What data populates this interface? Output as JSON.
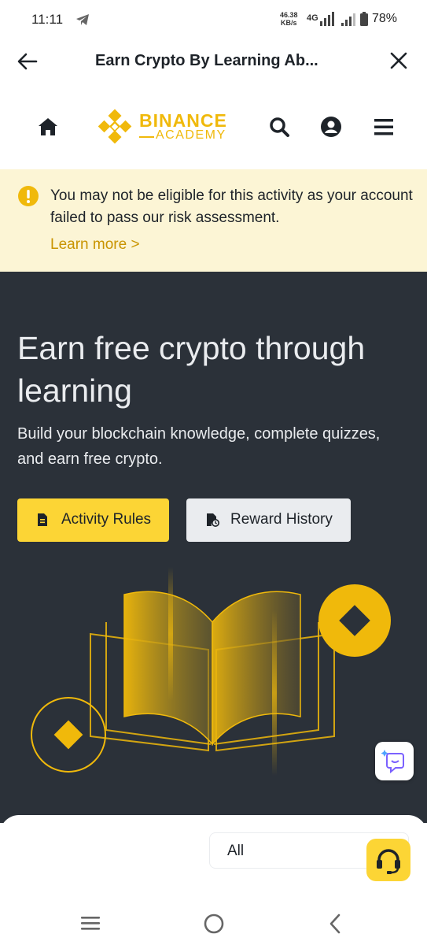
{
  "status_bar": {
    "time": "11:11",
    "net_speed_value": "46.38",
    "net_speed_unit": "KB/s",
    "network": "4G",
    "battery": "78%"
  },
  "nav": {
    "title": "Earn Crypto By Learning Ab..."
  },
  "header": {
    "logo_main": "BINANCE",
    "logo_sub": "ACADEMY",
    "icons": [
      "home-icon",
      "search-icon",
      "account-icon",
      "menu-icon"
    ]
  },
  "alert": {
    "message": "You may not be eligible for this activity as your account failed to pass our risk assessment.",
    "link": "Learn more >"
  },
  "hero": {
    "title": "Earn free crypto through learning",
    "subtitle": "Build your blockchain knowledge, complete quizzes, and earn free crypto.",
    "rules_button": "Activity Rules",
    "history_button": "Reward History"
  },
  "filter": {
    "selected": "All"
  },
  "colors": {
    "brand_yellow": "#fcd535",
    "gold": "#f0b90b",
    "hero_bg": "#2b3139",
    "alert_bg": "#fcf5d5",
    "link_gold": "#c99400"
  }
}
